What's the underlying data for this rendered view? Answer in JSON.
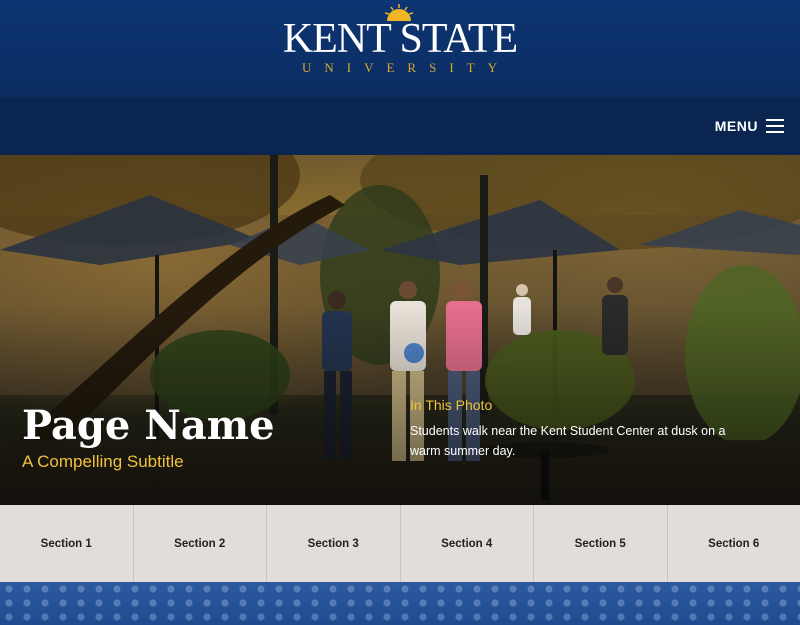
{
  "header": {
    "logo_wordmark": "KENT STATE",
    "logo_subtext": "UNIVERSITY"
  },
  "menubar": {
    "menu_label": "MENU"
  },
  "hero": {
    "page_name": "Page Name",
    "subtitle": "A Compelling Subtitle",
    "caption_title": "In This Photo",
    "caption_text": "Students walk near the Kent Student Center at dusk on a warm summer day."
  },
  "sections": [
    {
      "label": "Section 1"
    },
    {
      "label": "Section 2"
    },
    {
      "label": "Section 3"
    },
    {
      "label": "Section 4"
    },
    {
      "label": "Section 5"
    },
    {
      "label": "Section 6"
    }
  ],
  "icons": {
    "logo_sun": "sun-icon",
    "menu": "hamburger-menu-icon"
  },
  "colors": {
    "brand_navy": "#0a2c60",
    "brand_gold": "#f0c23b",
    "section_bg": "#e1ddd8"
  }
}
